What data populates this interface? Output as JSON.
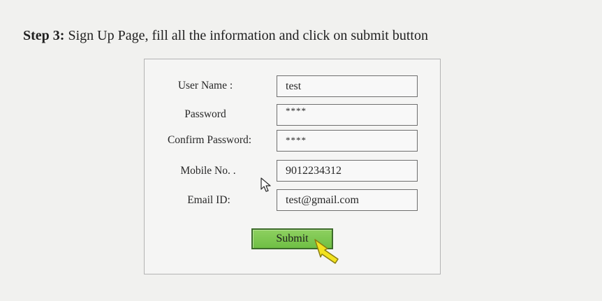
{
  "instruction": {
    "step": "Step 3:",
    "text": " Sign Up Page, fill all the information and click on submit button"
  },
  "form": {
    "fields": [
      {
        "label": "User Name :",
        "value": "test"
      },
      {
        "label": "Password",
        "value": "****"
      },
      {
        "label": "Confirm Password:",
        "value": "****"
      },
      {
        "label": "Mobile No. .",
        "value": "9012234312"
      },
      {
        "label": "Email ID:",
        "value": "test@gmail.com"
      }
    ],
    "submit_label": "Submit"
  },
  "colors": {
    "page_background": "#f1f1ef",
    "submit_button": "#7dc653",
    "hand_cursor": "#f2e21f"
  },
  "icons": {
    "pointer": "arrow-pointer-icon",
    "hand": "hand-pointer-icon"
  }
}
